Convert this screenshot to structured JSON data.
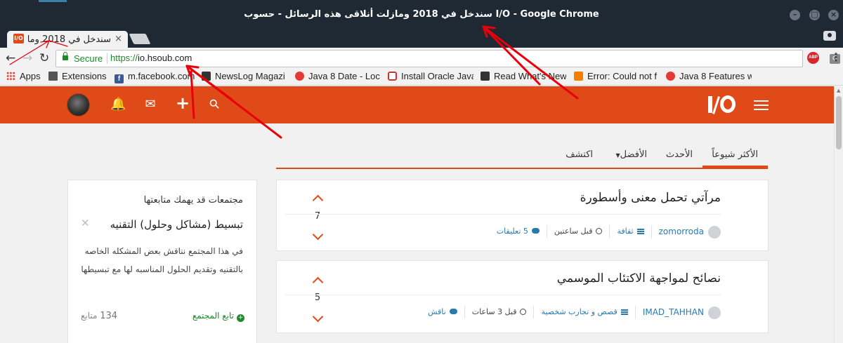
{
  "window": {
    "title": "سندخل في 2018 ومازلت أنلاقى هذه الرسائل - حسوب I/O - Google Chrome",
    "minimize_glyph": "–",
    "maximize_glyph": "□",
    "close_glyph": "×"
  },
  "tab": {
    "title": "سندخل في 2018 ومازلت",
    "favicon_text": "I/O",
    "close_glyph": "×"
  },
  "toolbar": {
    "back_glyph": "←",
    "forward_glyph": "→",
    "reload_glyph": "↻",
    "secure_label": "Secure",
    "url_scheme": "https://",
    "url_host": "io.hsoub.com",
    "star_glyph": "☆",
    "translate_glyph": "G",
    "abp_text": "ABP",
    "menu_glyph": "⋮"
  },
  "bookmarks": [
    {
      "label": "Apps",
      "icon": "apps-icon"
    },
    {
      "label": "Extensions",
      "icon": "puzzle-icon"
    },
    {
      "label": "m.facebook.com",
      "icon": "facebook-icon"
    },
    {
      "label": "NewsLog Magazi",
      "icon": "newslog-icon"
    },
    {
      "label": "Java 8 Date - Loc",
      "icon": "java-icon"
    },
    {
      "label": "Install Oracle Java",
      "icon": "oracle-icon"
    },
    {
      "label": "Read What's New",
      "icon": "book-icon"
    },
    {
      "label": "Error: Could not f",
      "icon": "blogger-icon"
    },
    {
      "label": "Java 8 Features w",
      "icon": "java-icon"
    }
  ],
  "header": {
    "icons": [
      "avatar",
      "bell-icon",
      "envelope-icon",
      "plus-icon",
      "search-icon"
    ],
    "bell_glyph": "🔔",
    "envelope_glyph": "✉",
    "plus_glyph": "+",
    "search_glyph": "⚲",
    "brand_color": "#e04a18"
  },
  "nav": {
    "tabs": [
      {
        "label": "الأكثر شيوعاً",
        "active": true
      },
      {
        "label": "الأحدث",
        "active": false
      },
      {
        "label": "الأفضل",
        "active": false,
        "dropdown": true
      },
      {
        "label": "اكتشف",
        "active": false
      }
    ],
    "caret_glyph": "▼"
  },
  "sidebar": {
    "heading": "مجتمعات قد يهمك متابعتها",
    "community_name": "تبسيط (مشاكل وحلول) التقنيه",
    "close_glyph": "✕",
    "description": "في هذا المجتمع نناقش بعض المشكله الخاصه بالتقنيه وتقديم الحلول المناسبه لها مع تبسيطها",
    "follow_label": "تابع المجتمع",
    "follow_glyph": "+",
    "followers_count": "134",
    "followers_label": "متابع"
  },
  "posts": [
    {
      "score": "7",
      "title": "مرآتي تحمل معنى وأسطورة",
      "author": "zomorroda",
      "category": "ثقافة",
      "time": "قبل ساعتين",
      "comments": "5 تعليقات"
    },
    {
      "score": "5",
      "title": "نصائح لمواجهة الاكتئاب الموسمي",
      "author": "IMAD_TAHHAN",
      "category": "قصص و تجارب شخصية",
      "time": "قبل 3 ساعات",
      "comments": "ناقش"
    }
  ]
}
